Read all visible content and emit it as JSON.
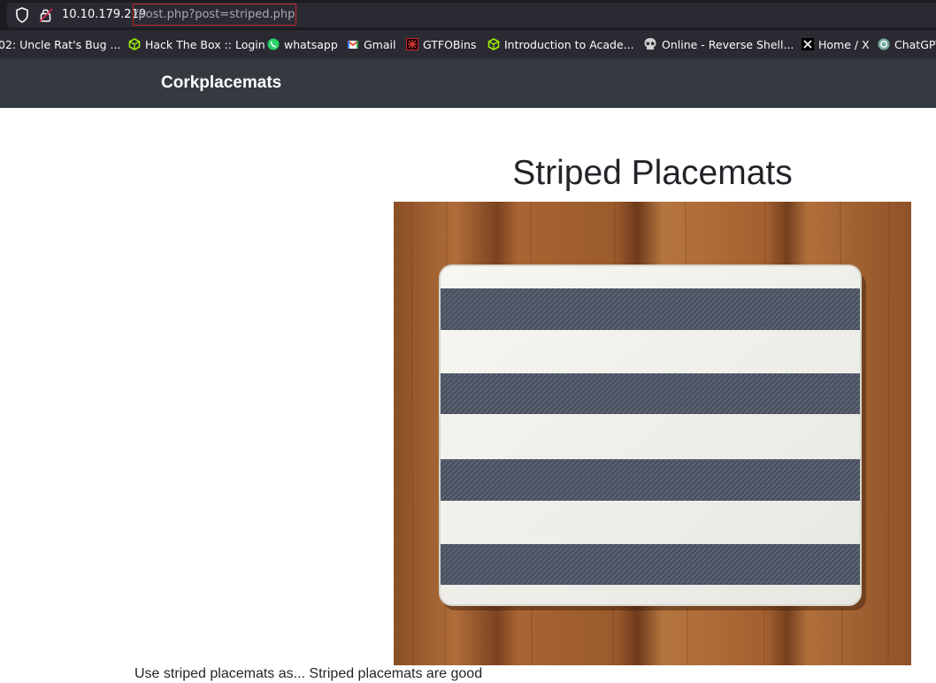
{
  "browser": {
    "url_host": "10.10.179.219",
    "url_path": "/post.php?post=striped.php",
    "bookmarks": [
      {
        "label": "02: Uncle Rat's Bug ...",
        "icon": "bookmark-icon"
      },
      {
        "label": "Hack The Box :: Login",
        "icon": "hackthebox-icon"
      },
      {
        "label": "whatsapp",
        "icon": "whatsapp-icon"
      },
      {
        "label": "Gmail",
        "icon": "gmail-icon"
      },
      {
        "label": "GTFOBins",
        "icon": "gtfobins-icon"
      },
      {
        "label": "Introduction to Acade...",
        "icon": "hackthebox-icon"
      },
      {
        "label": "Online - Reverse Shell...",
        "icon": "skull-icon"
      },
      {
        "label": "Home / X",
        "icon": "x-logo-icon"
      },
      {
        "label": "ChatGPT",
        "icon": "chatgpt-icon"
      }
    ],
    "colors": {
      "highlight": "#c0272d",
      "toolbar": "#1c1b22"
    }
  },
  "site": {
    "brand": "Corkplacemats",
    "header_color": "#343a40"
  },
  "post": {
    "title": "Striped Placemats",
    "image_description": "placemat-photo",
    "text": "Use striped placemats as... Striped placemats are good"
  }
}
